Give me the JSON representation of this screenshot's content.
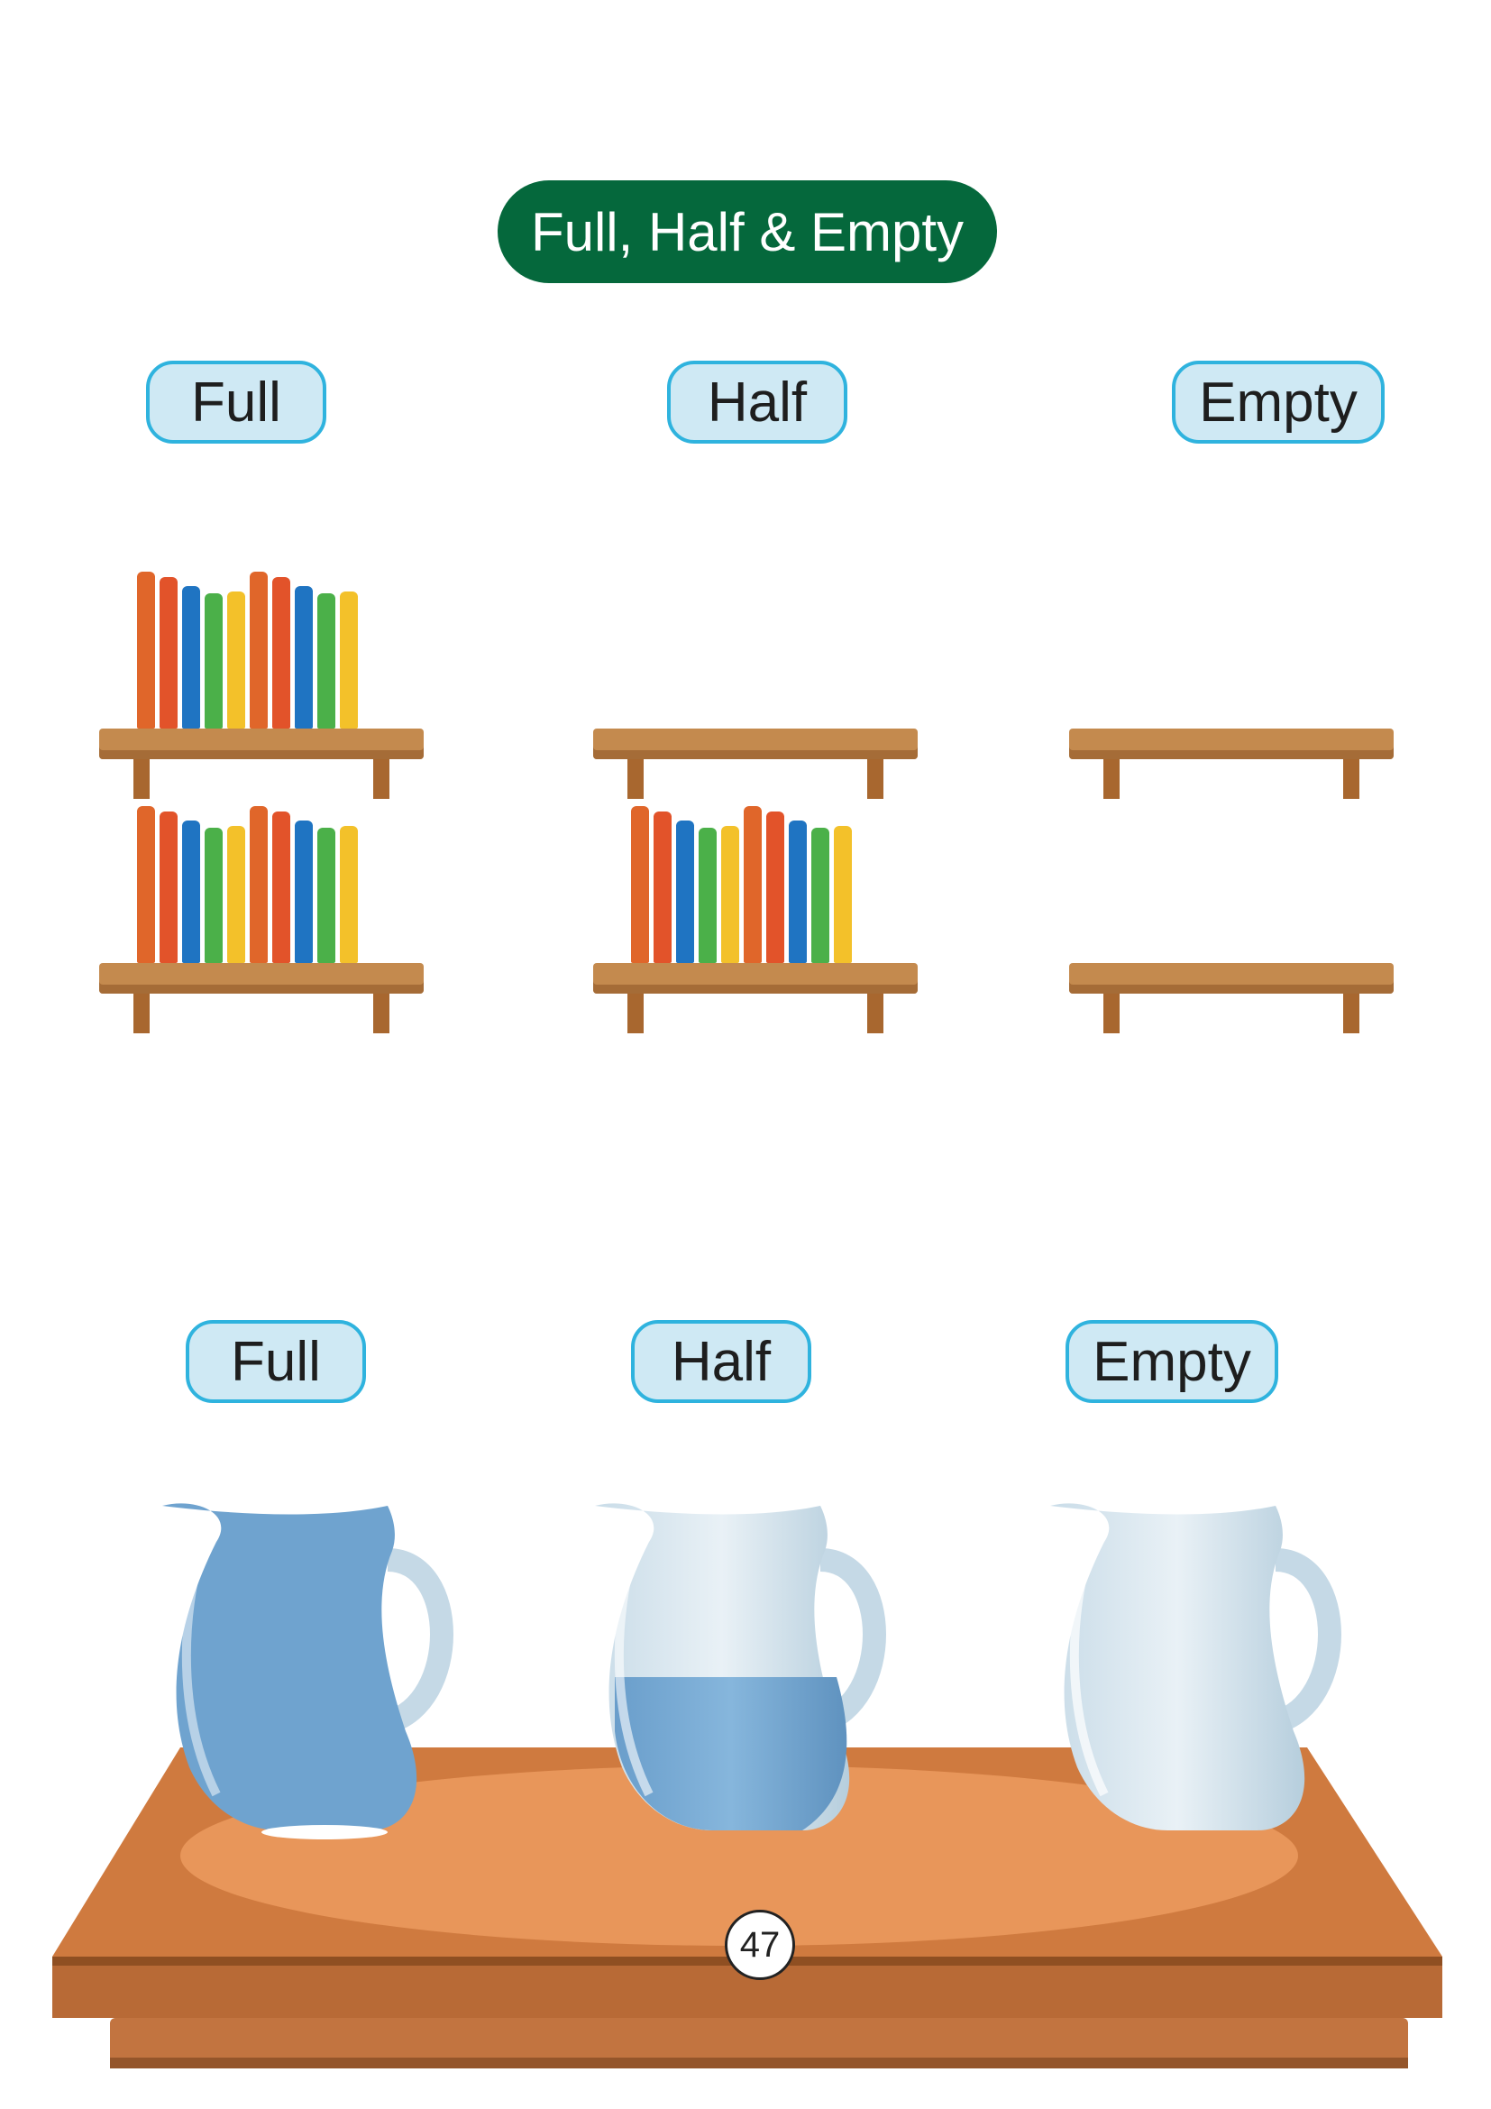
{
  "title": "Full, Half & Empty",
  "shelves_section": {
    "labels": [
      "Full",
      "Half",
      "Empty"
    ]
  },
  "jugs_section": {
    "labels": [
      "Full",
      "Half",
      "Empty"
    ]
  },
  "page_number": "47",
  "colors": {
    "title_bg": "#05683c",
    "label_bg": "#cfe9f4",
    "label_border": "#2fb3de",
    "shelf": "#c48a4e",
    "water": "#74a9d4",
    "table": "#d27a40"
  },
  "book_colors": [
    "#e0662a",
    "#e2532a",
    "#1f74c2",
    "#4bb049",
    "#f3c12a",
    "#e0662a",
    "#e2532a",
    "#1f74c2",
    "#4bb049",
    "#f3c12a"
  ]
}
